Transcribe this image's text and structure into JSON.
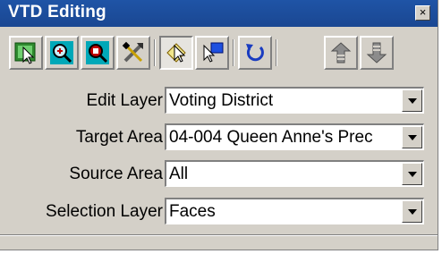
{
  "window": {
    "title": "VTD Editing",
    "close_label": "×"
  },
  "toolbar": {
    "buttons": [
      {
        "name": "select-tool",
        "icon": "select-arrow-icon"
      },
      {
        "name": "zoom-in-tool",
        "icon": "magnifier-icon"
      },
      {
        "name": "zoom-selection-tool",
        "icon": "magnifier-map-icon"
      },
      {
        "name": "tools-settings",
        "icon": "tools-icon"
      },
      {
        "name": "pointer-select",
        "icon": "pointer-select-icon"
      },
      {
        "name": "pointer-move",
        "icon": "pointer-move-icon"
      },
      {
        "name": "undo",
        "icon": "undo-icon"
      },
      {
        "name": "layer-up",
        "icon": "layer-up-icon"
      },
      {
        "name": "layer-down",
        "icon": "layer-down-icon"
      }
    ]
  },
  "fields": {
    "edit_layer": {
      "label": "Edit Layer",
      "value": "Voting District"
    },
    "target_area": {
      "label": "Target Area",
      "value": "04-004 Queen Anne's Prec"
    },
    "source_area": {
      "label": "Source Area",
      "value": "All"
    },
    "selection_layer": {
      "label": "Selection Layer",
      "value": "Faces"
    }
  },
  "colors": {
    "titlebar": "#1f54a6",
    "face": "#d4d0c8"
  }
}
